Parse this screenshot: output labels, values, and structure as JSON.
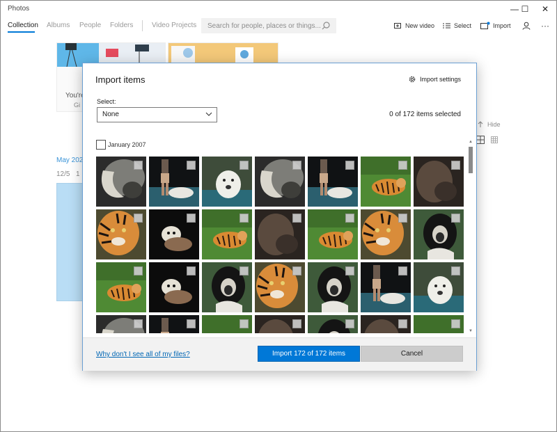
{
  "app": {
    "title": "Photos"
  },
  "window_controls": {
    "minimize": "—",
    "maximize": "☐",
    "close": "✕"
  },
  "nav": {
    "tabs": [
      {
        "label": "Collection",
        "active": true
      },
      {
        "label": "Albums"
      },
      {
        "label": "People"
      },
      {
        "label": "Folders"
      },
      {
        "label": "Video Projects"
      }
    ],
    "search_placeholder": "Search for people, places or things...",
    "commands": {
      "new_video": "New video",
      "select": "Select",
      "import": "Import",
      "more": "···"
    }
  },
  "background": {
    "card_text": "You're",
    "card_subtext": "Gi",
    "hide_label": "Hide",
    "month_label": "May 2020",
    "day_label": "12/5",
    "day_label_2": "1"
  },
  "dialog": {
    "title": "Import items",
    "settings_label": "Import settings",
    "select_label": "Select:",
    "select_value": "None",
    "selection_count": "0 of 172 items selected",
    "group_label": "January 2007",
    "help_link": "Why don't I see all of my files?",
    "import_button": "Import 172 of 172 items",
    "cancel_button": "Cancel",
    "thumbnails": [
      "elephant",
      "person-water",
      "polar-bear",
      "elephant",
      "person-water",
      "tiger-grass",
      "dark-animal",
      "tiger",
      "otter",
      "tiger-grass",
      "dark-animal",
      "tiger-grass",
      "tiger",
      "monkey",
      "tiger-grass",
      "otter",
      "monkey",
      "tiger",
      "monkey",
      "person-water",
      "polar-bear",
      "elephant",
      "person-water",
      "tiger-grass",
      "dark-animal",
      "monkey",
      "dark-animal",
      "tiger-grass"
    ]
  },
  "colors": {
    "accent": "#0078d7",
    "link": "#0066b4",
    "cancel_bg": "#cccccc",
    "footer_bg": "#f2f2f2"
  }
}
